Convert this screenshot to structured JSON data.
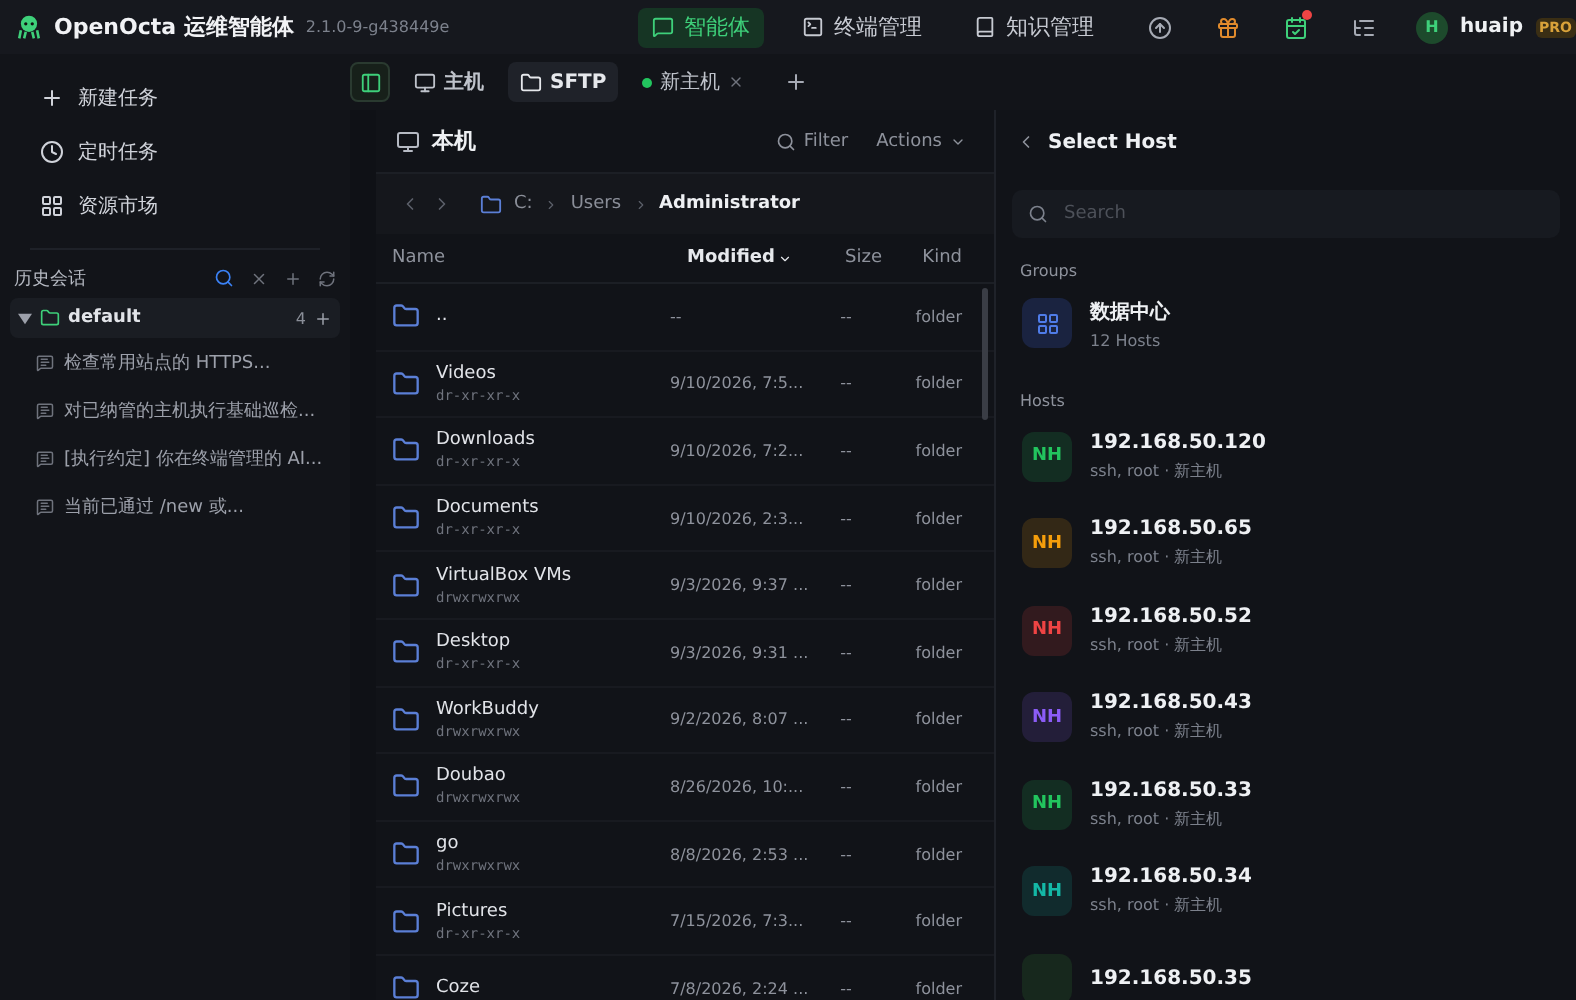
{
  "app": {
    "name": "OpenOcta 运维智能体",
    "version": "2.1.0-9-g438449e"
  },
  "nav": [
    {
      "kind": "agent",
      "label": "智能体",
      "selected": true
    },
    {
      "kind": "terminal",
      "label": "终端管理",
      "selected": false
    },
    {
      "kind": "book",
      "label": "知识管理",
      "selected": false
    }
  ],
  "toolbar": [
    {
      "kind": "upload",
      "badge": false
    },
    {
      "kind": "gift",
      "badge": false
    },
    {
      "kind": "calendar",
      "badge": true
    },
    {
      "kind": "list",
      "badge": false
    }
  ],
  "user": {
    "initial": "H",
    "name": "huaip",
    "badge": "PRO"
  },
  "sidebar": {
    "actions": [
      {
        "kind": "plus",
        "label": "新建任务"
      },
      {
        "kind": "clock",
        "label": "定时任务"
      },
      {
        "kind": "grid",
        "label": "资源市场"
      }
    ],
    "history_title": "历史会话",
    "folder": {
      "name": "default",
      "count": "4",
      "expanded": true,
      "children": [
        {
          "label": "检查常用站点的 HTTPS..."
        },
        {
          "label": "对已纳管的主机执行基础巡检..."
        },
        {
          "label": "[执行约定] 你在终端管理的 AI..."
        },
        {
          "label": "当前已通过 /new 或..."
        }
      ]
    }
  },
  "tabs": [
    {
      "kind": "monitor",
      "label": "主机",
      "selected": false
    },
    {
      "kind": "folder",
      "label": "SFTP",
      "selected": true
    },
    {
      "kind": "session",
      "label": "新主机",
      "selected": false,
      "color": "#22c55e"
    }
  ],
  "file_panel": {
    "title": "本机",
    "filter": "Filter",
    "actions": "Actions",
    "path": [
      "C:",
      "Users",
      "Administrator"
    ],
    "columns": [
      {
        "label": "Name",
        "sorted": false
      },
      {
        "label": "Modified",
        "sorted": true
      },
      {
        "label": "Size",
        "sorted": false
      },
      {
        "label": "Kind",
        "sorted": false
      }
    ],
    "rows": [
      {
        "name": "..",
        "modified": "--",
        "size": "--",
        "kind": "folder"
      },
      {
        "name": "Videos",
        "perms": "dr-xr-xr-x",
        "modified": "9/10/2026, 7:5...",
        "size": "--",
        "kind": "folder"
      },
      {
        "name": "Downloads",
        "perms": "dr-xr-xr-x",
        "modified": "9/10/2026, 7:2...",
        "size": "--",
        "kind": "folder"
      },
      {
        "name": "Documents",
        "perms": "dr-xr-xr-x",
        "modified": "9/10/2026, 2:3...",
        "size": "--",
        "kind": "folder"
      },
      {
        "name": "VirtualBox VMs",
        "perms": "drwxrwxrwx",
        "modified": "9/3/2026, 9:37 ...",
        "size": "--",
        "kind": "folder"
      },
      {
        "name": "Desktop",
        "perms": "dr-xr-xr-x",
        "modified": "9/3/2026, 9:31 ...",
        "size": "--",
        "kind": "folder"
      },
      {
        "name": "WorkBuddy",
        "perms": "drwxrwxrwx",
        "modified": "9/2/2026, 8:07 ...",
        "size": "--",
        "kind": "folder"
      },
      {
        "name": "Doubao",
        "perms": "drwxrwxrwx",
        "modified": "8/26/2026, 10:...",
        "size": "--",
        "kind": "folder"
      },
      {
        "name": "go",
        "perms": "drwxrwxrwx",
        "modified": "8/8/2026, 2:53 ...",
        "size": "--",
        "kind": "folder"
      },
      {
        "name": "Pictures",
        "perms": "dr-xr-xr-x",
        "modified": "7/15/2026, 7:3...",
        "size": "--",
        "kind": "folder"
      },
      {
        "name": "Coze",
        "modified": "7/8/2026, 2:24 ...",
        "size": "--",
        "kind": "folder"
      }
    ]
  },
  "host_panel": {
    "title": "Select Host",
    "search": {
      "placeholder": "Search"
    },
    "groups_label": "Groups",
    "groups": [
      {
        "name": "数据中心",
        "count": "12 Hosts"
      }
    ],
    "hosts_label": "Hosts",
    "hosts": [
      {
        "initials": "NH",
        "ip": "192.168.50.120",
        "detail": "ssh, root · 新主机",
        "color": "#22c55e"
      },
      {
        "initials": "NH",
        "ip": "192.168.50.65",
        "detail": "ssh, root · 新主机",
        "color": "#f59e0b"
      },
      {
        "initials": "NH",
        "ip": "192.168.50.52",
        "detail": "ssh, root · 新主机",
        "color": "#ef4444"
      },
      {
        "initials": "NH",
        "ip": "192.168.50.43",
        "detail": "ssh, root · 新主机",
        "color": "#8b5cf6"
      },
      {
        "initials": "NH",
        "ip": "192.168.50.33",
        "detail": "ssh, root · 新主机",
        "color": "#22c55e"
      },
      {
        "initials": "NH",
        "ip": "192.168.50.34",
        "detail": "ssh, root · 新主机",
        "color": "#14b8a6"
      },
      {
        "ip": "192.168.50.35"
      }
    ]
  }
}
